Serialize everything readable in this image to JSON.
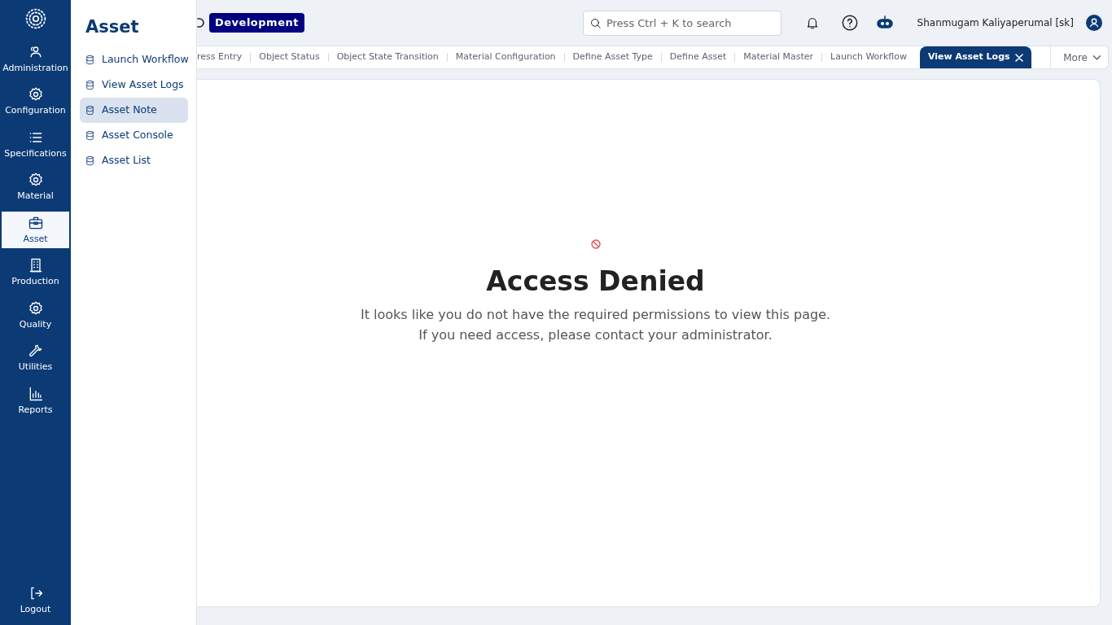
{
  "rail": {
    "items": [
      {
        "label": "Administration",
        "selected": false
      },
      {
        "label": "Configuration",
        "selected": false
      },
      {
        "label": "Specifications",
        "selected": false
      },
      {
        "label": "Material",
        "selected": false
      },
      {
        "label": "Asset",
        "selected": true
      },
      {
        "label": "Production",
        "selected": false
      },
      {
        "label": "Quality",
        "selected": false
      },
      {
        "label": "Utilities",
        "selected": false
      },
      {
        "label": "Reports",
        "selected": false
      }
    ],
    "footer": {
      "label": "Logout"
    }
  },
  "flyout": {
    "title": "Asset",
    "items": [
      {
        "label": "Launch Workflow",
        "selected": false
      },
      {
        "label": "View Asset Logs",
        "selected": false
      },
      {
        "label": "Asset Note",
        "selected": true
      },
      {
        "label": "Asset Console",
        "selected": false
      },
      {
        "label": "Asset List",
        "selected": false
      }
    ]
  },
  "header": {
    "env_badge": "Development",
    "search": {
      "placeholder": "Press Ctrl + K to search"
    },
    "user_name": "Shanmugam Kaliyaperumal [sk]"
  },
  "tabs": [
    {
      "label": "ress Entry",
      "selected": false
    },
    {
      "label": "Object Status",
      "selected": false
    },
    {
      "label": "Object State Transition",
      "selected": false
    },
    {
      "label": "Material Configuration",
      "selected": false
    },
    {
      "label": "Define Asset Type",
      "selected": false
    },
    {
      "label": "Define Asset",
      "selected": false
    },
    {
      "label": "Material Master",
      "selected": false
    },
    {
      "label": "Launch Workflow",
      "selected": false
    },
    {
      "label": "View Asset Logs",
      "selected": true
    }
  ],
  "more": "More",
  "message": {
    "title": "Access Denied",
    "lines": [
      "It looks like you do not have the required permissions to view this page.",
      "If you need access, please contact your administrator."
    ]
  }
}
